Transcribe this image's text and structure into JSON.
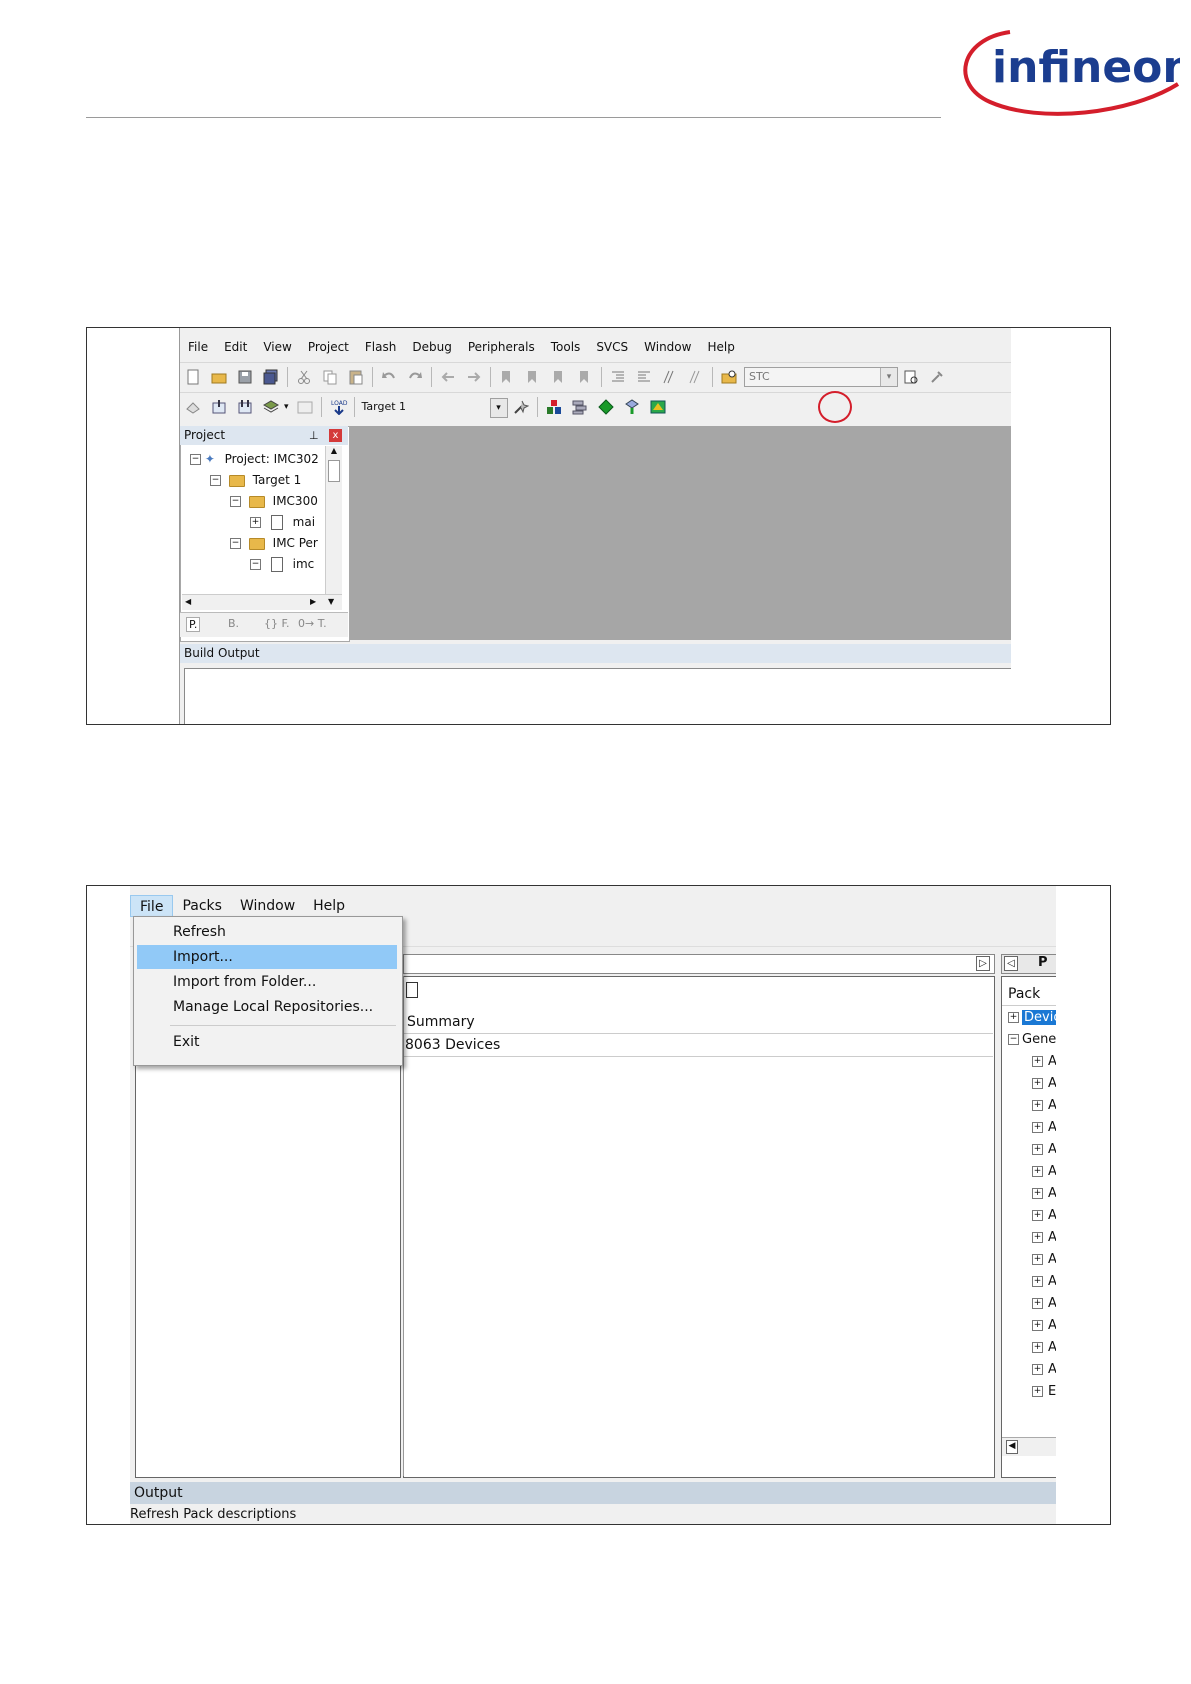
{
  "brand": {
    "logo_text": "infineon",
    "logo_color": "#1b3d8f",
    "swoosh_color": "#d41e2b"
  },
  "fig1": {
    "menu": [
      "File",
      "Edit",
      "View",
      "Project",
      "Flash",
      "Debug",
      "Peripherals",
      "Tools",
      "SVCS",
      "Window",
      "Help"
    ],
    "toolbar1_combo": "STC",
    "toolbar2_target": "Target 1",
    "load_label": "LOAD",
    "project_panel_title": "Project",
    "tree": [
      {
        "label": "Project: IMC302"
      },
      {
        "label": "Target 1"
      },
      {
        "label": "IMC300"
      },
      {
        "label": "mai"
      },
      {
        "label": "IMC Per"
      },
      {
        "label": "imc"
      }
    ],
    "panel_tabs": [
      "P.",
      "B.",
      "{} F.",
      "0→ T."
    ],
    "build_output_title": "Build Output",
    "highlight_color": "#d41e2b"
  },
  "fig2": {
    "menu": [
      "File",
      "Packs",
      "Window",
      "Help"
    ],
    "file_menu": [
      "Refresh",
      "Import...",
      "Import from Folder...",
      "Manage Local Repositories...",
      "Exit"
    ],
    "summary_header": "Summary",
    "summary_value": "8063 Devices",
    "right_tab_label": "P",
    "right_header": "Pack",
    "right_tree": [
      "Devic",
      "Gene",
      "A",
      "A",
      "A",
      "A",
      "A",
      "A",
      "A",
      "A",
      "A",
      "A",
      "A",
      "A",
      "A",
      "A",
      "A",
      "E"
    ],
    "output_title": "Output",
    "status_text": "Refresh Pack descriptions",
    "highlight_color": "#91c9f7"
  }
}
